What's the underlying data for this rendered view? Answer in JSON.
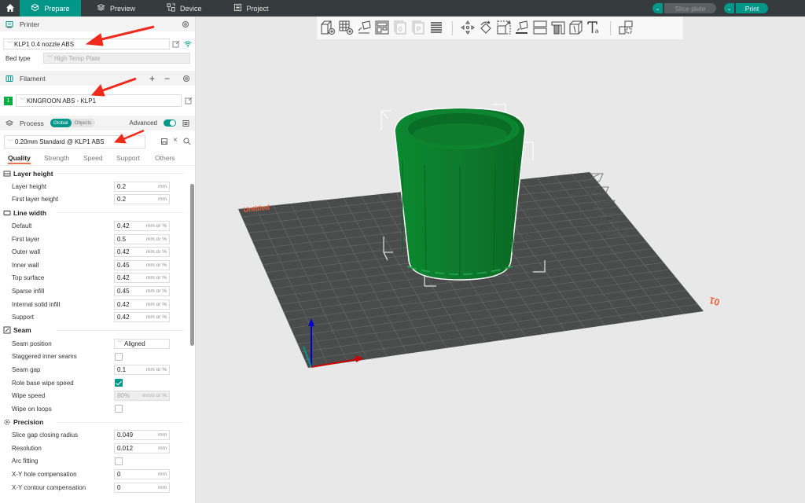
{
  "topbar": {
    "home_icon": "home-icon",
    "tabs": [
      {
        "label": "Prepare",
        "icon": "cube-icon",
        "active": true
      },
      {
        "label": "Preview",
        "icon": "layers-icon",
        "active": false
      },
      {
        "label": "Device",
        "icon": "device-icon",
        "active": false
      },
      {
        "label": "Project",
        "icon": "project-icon",
        "active": false
      }
    ],
    "slice_label": "Slice plate",
    "print_label": "Print"
  },
  "printer": {
    "section_title": "Printer",
    "selected": "KLP1 0.4 nozzle ABS",
    "bed_type_label": "Bed type",
    "bed_type_value": "High Temp Plate"
  },
  "filament": {
    "section_title": "Filament",
    "add": "+",
    "remove": "−",
    "slot_number": "1",
    "selected": "KINGROON ABS - KLP1",
    "slot_color": "#00ae42"
  },
  "process": {
    "section_title": "Process",
    "scope_global": "Global",
    "scope_objects": "Objects",
    "advanced_label": "Advanced",
    "advanced_on": true,
    "preset": "0.20mm Standard @ KLP1 ABS",
    "subtabs": [
      "Quality",
      "Strength",
      "Speed",
      "Support",
      "Others"
    ],
    "active_subtab": "Quality"
  },
  "settings": {
    "layer_height": {
      "title": "Layer height",
      "items": [
        {
          "label": "Layer height",
          "value": "0.2",
          "unit": "mm"
        },
        {
          "label": "First layer height",
          "value": "0.2",
          "unit": "mm"
        }
      ]
    },
    "line_width": {
      "title": "Line width",
      "items": [
        {
          "label": "Default",
          "value": "0.42",
          "unit": "mm or %"
        },
        {
          "label": "First layer",
          "value": "0.5",
          "unit": "mm or %"
        },
        {
          "label": "Outer wall",
          "value": "0.42",
          "unit": "mm or %"
        },
        {
          "label": "Inner wall",
          "value": "0.45",
          "unit": "mm or %"
        },
        {
          "label": "Top surface",
          "value": "0.42",
          "unit": "mm or %"
        },
        {
          "label": "Sparse infill",
          "value": "0.45",
          "unit": "mm or %"
        },
        {
          "label": "Internal solid infill",
          "value": "0.42",
          "unit": "mm or %"
        },
        {
          "label": "Support",
          "value": "0.42",
          "unit": "mm or %"
        }
      ]
    },
    "seam": {
      "title": "Seam",
      "seam_position_label": "Seam position",
      "seam_position_value": "Aligned",
      "staggered_label": "Staggered inner seams",
      "staggered_checked": false,
      "seam_gap_label": "Seam gap",
      "seam_gap_value": "0.1",
      "seam_gap_unit": "mm or %",
      "role_wipe_label": "Role base wipe speed",
      "role_wipe_checked": true,
      "wipe_speed_label": "Wipe speed",
      "wipe_speed_value": "80%",
      "wipe_speed_unit": "mm/s or %",
      "wipe_loops_label": "Wipe on loops",
      "wipe_loops_checked": false
    },
    "precision": {
      "title": "Precision",
      "slice_gap_label": "Slice gap closing radius",
      "slice_gap_value": "0.049",
      "slice_gap_unit": "mm",
      "resolution_label": "Resolution",
      "resolution_value": "0.012",
      "resolution_unit": "mm",
      "arc_label": "Arc fitting",
      "arc_checked": false,
      "xy_hole_label": "X-Y hole compensation",
      "xy_hole_value": "0",
      "xy_hole_unit": "mm",
      "xy_contour_label": "X-Y contour compensation",
      "xy_contour_value": "0",
      "xy_contour_unit": "mm"
    }
  },
  "viewport": {
    "plate_name": "Untitled",
    "plate_number": "01",
    "model_color": "#0a7d2c",
    "bed_color": "#4a4c4c",
    "label_color": "#f0603a",
    "toolbar": [
      "add-object-icon",
      "add-plate-icon",
      "auto-orient-icon",
      "arrange-icon",
      "plate-0-icon",
      "plate-p-icon",
      "layers-list-icon",
      "move-icon",
      "rotate-icon",
      "scale-icon",
      "lay-on-face-icon",
      "cut-icon",
      "support-paint-icon",
      "seam-paint-icon",
      "text-icon",
      "assembly-icon"
    ],
    "plate_tools": [
      "delete-plate-icon",
      "orient-plate-icon",
      "arrange-plate-icon",
      "lock-plate-icon",
      "plate-settings-icon"
    ]
  }
}
